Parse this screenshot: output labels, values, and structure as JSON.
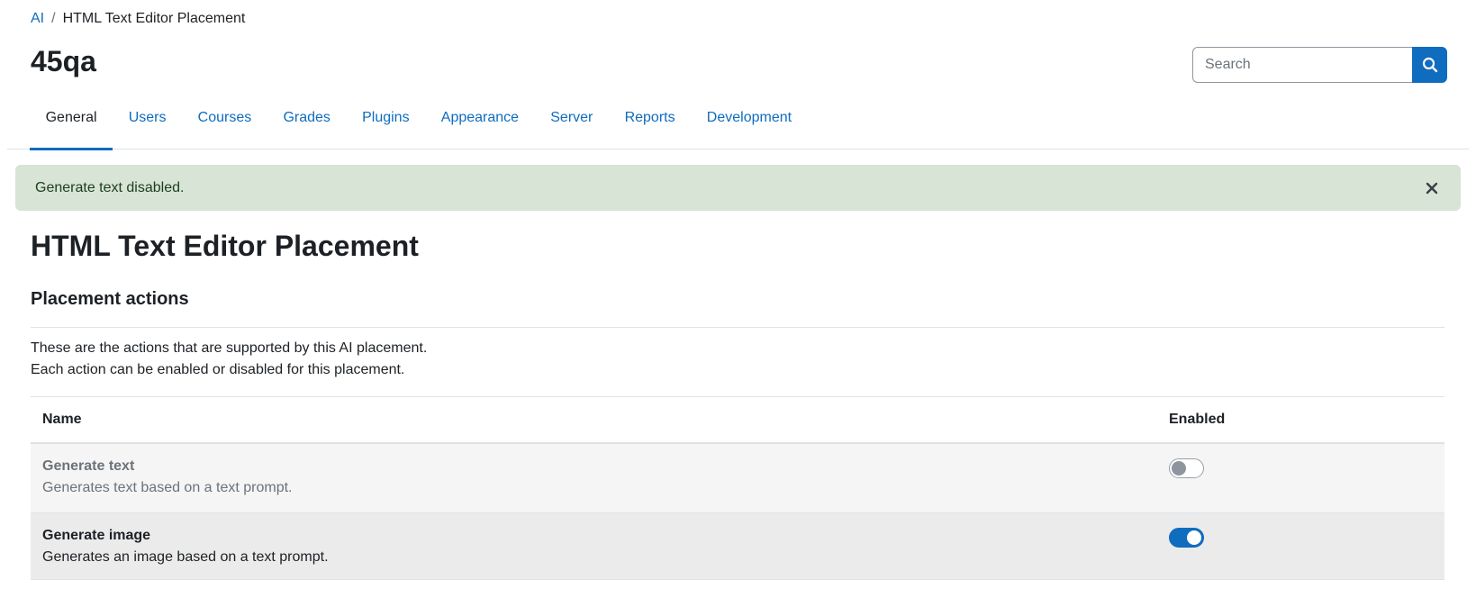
{
  "breadcrumb": {
    "parent": "AI",
    "separator": "/",
    "current": "HTML Text Editor Placement"
  },
  "site_title": "45qa",
  "search": {
    "placeholder": "Search",
    "icon": "search-icon"
  },
  "tabs": [
    {
      "label": "General",
      "active": true
    },
    {
      "label": "Users"
    },
    {
      "label": "Courses"
    },
    {
      "label": "Grades"
    },
    {
      "label": "Plugins"
    },
    {
      "label": "Appearance"
    },
    {
      "label": "Server"
    },
    {
      "label": "Reports"
    },
    {
      "label": "Development"
    }
  ],
  "alert": {
    "message": "Generate text disabled.",
    "close_icon": "close-icon"
  },
  "page_heading": "HTML Text Editor Placement",
  "section": {
    "title": "Placement actions",
    "description_line1": "These are the actions that are supported by this AI placement.",
    "description_line2": "Each action can be enabled or disabled for this placement."
  },
  "table": {
    "headers": {
      "name": "Name",
      "enabled": "Enabled"
    },
    "rows": [
      {
        "name": "Generate text",
        "description": "Generates text based on a text prompt.",
        "enabled": false
      },
      {
        "name": "Generate image",
        "description": "Generates an image based on a text prompt.",
        "enabled": true
      }
    ]
  },
  "colors": {
    "brand": "#0f6cbf",
    "alert_bg": "#d7e4d6",
    "alert_text": "#1c3f1a"
  }
}
